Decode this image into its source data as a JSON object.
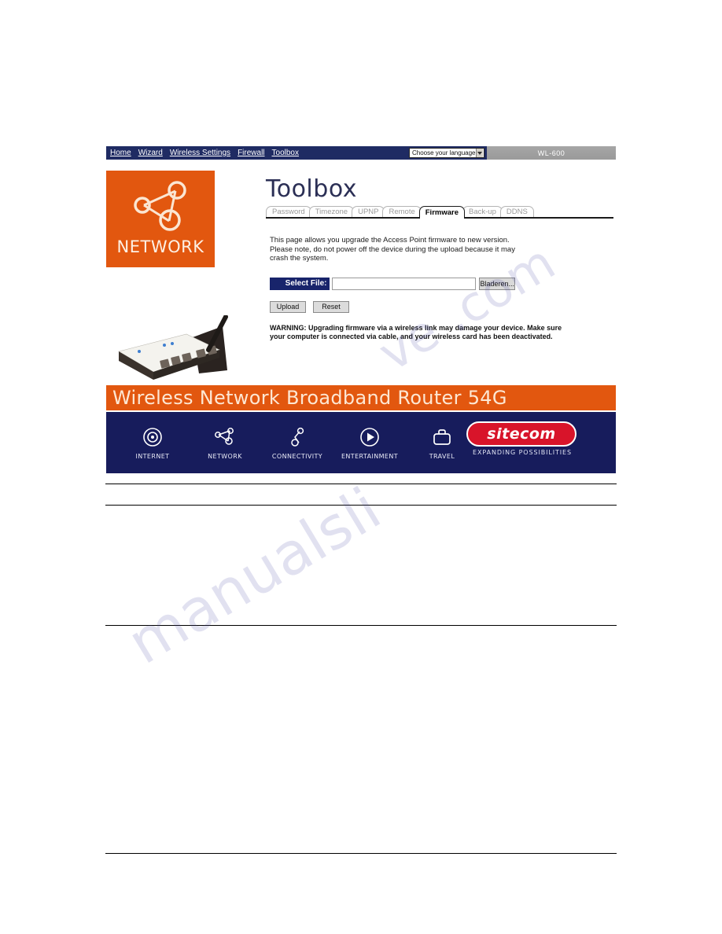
{
  "navbar": {
    "links": [
      {
        "label": "Home"
      },
      {
        "label": "Wizard"
      },
      {
        "label": "Wireless Settings"
      },
      {
        "label": "Firewall"
      },
      {
        "label": "Toolbox"
      }
    ],
    "language_select": {
      "value": "Choose your language",
      "icon": "chevron-down-icon"
    },
    "model_badge": "WL-600"
  },
  "logo": {
    "label": "NETWORK",
    "icon": "network-nodes-icon",
    "background": "#e2570f"
  },
  "product_image": {
    "icon": "wireless-router-photo"
  },
  "page": {
    "title": "Toolbox",
    "tabs": [
      {
        "label": "Password",
        "active": false
      },
      {
        "label": "Timezone",
        "active": false
      },
      {
        "label": "UPNP",
        "active": false
      },
      {
        "label": "Remote",
        "active": false
      },
      {
        "label": "Firmware",
        "active": true
      },
      {
        "label": "Back-up",
        "active": false
      },
      {
        "label": "DDNS",
        "active": false
      }
    ],
    "intro": "This page allows you upgrade the Access Point firmware to new version. Please note, do not power off the device during the upload because it may crash the system.",
    "file_row": {
      "label": "Select File:",
      "value": "",
      "placeholder": "",
      "browse_label": "Bladeren..."
    },
    "buttons": [
      {
        "label": "Upload"
      },
      {
        "label": "Reset"
      }
    ],
    "warning": "WARNING: Upgrading firmware via a wireless link may damage your device. Make sure your computer is connected via cable, and your wireless card has been deactivated."
  },
  "product_banner": {
    "text": "Wireless Network Broadband Router 54G",
    "background": "#e2570f"
  },
  "footer": {
    "background": "#171c5c",
    "categories": [
      {
        "label": "INTERNET",
        "icon": "concentric-circles-icon"
      },
      {
        "label": "NETWORK",
        "icon": "network-nodes-icon"
      },
      {
        "label": "CONNECTIVITY",
        "icon": "two-node-link-icon"
      },
      {
        "label": "ENTERTAINMENT",
        "icon": "play-circle-icon"
      },
      {
        "label": "TRAVEL",
        "icon": "briefcase-icon"
      }
    ],
    "brand": {
      "name": "sitecom",
      "tagline": "EXPANDING POSSIBILITIES",
      "color": "#d8142a"
    }
  },
  "watermark": {
    "line1": "ve .com",
    "line2": "manualsli"
  }
}
